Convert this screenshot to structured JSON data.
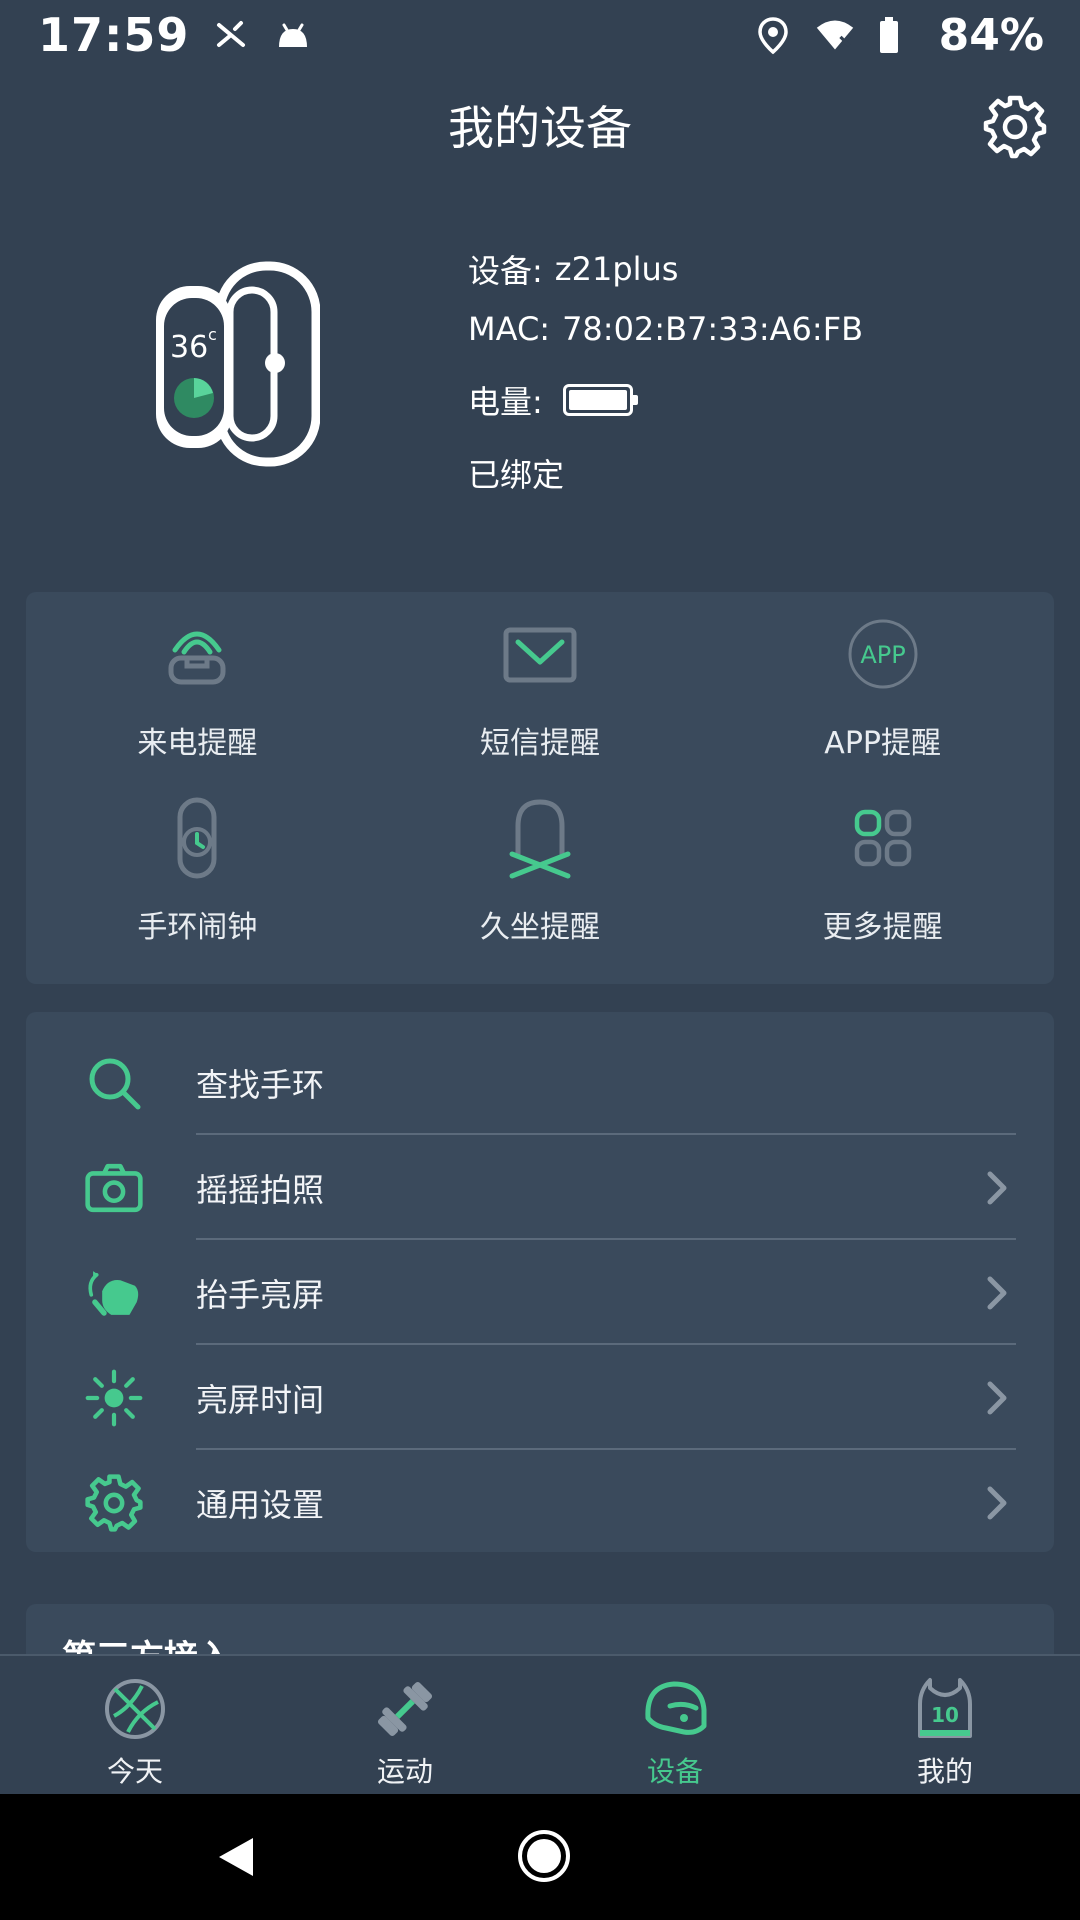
{
  "status": {
    "time": "17:59",
    "battery_percent": "84%"
  },
  "header": {
    "title": "我的设备"
  },
  "device": {
    "name_label": "设备:",
    "name_value": "z21plus",
    "mac_label": "MAC:",
    "mac_value": "78:02:B7:33:A6:FB",
    "battery_label": "电量:",
    "battery_level": 1.0,
    "bound_status": "已绑定",
    "band_display_temp": "36",
    "band_display_unit": "c"
  },
  "reminders": [
    {
      "label": "来电提醒",
      "icon": "phone-call-icon"
    },
    {
      "label": "短信提醒",
      "icon": "envelope-icon"
    },
    {
      "label": "APP提醒",
      "icon": "app-badge-icon",
      "badge_text": "APP"
    },
    {
      "label": "手环闹钟",
      "icon": "band-alarm-icon"
    },
    {
      "label": "久坐提醒",
      "icon": "sedentary-bell-icon"
    },
    {
      "label": "更多提醒",
      "icon": "more-grid-icon"
    }
  ],
  "settings_list": [
    {
      "label": "查找手环",
      "icon": "search-icon",
      "has_chevron": false
    },
    {
      "label": "摇摇拍照",
      "icon": "camera-icon",
      "has_chevron": true
    },
    {
      "label": "抬手亮屏",
      "icon": "raise-hand-icon",
      "has_chevron": true
    },
    {
      "label": "亮屏时间",
      "icon": "brightness-icon",
      "has_chevron": true
    },
    {
      "label": "通用设置",
      "icon": "gear-icon",
      "has_chevron": true
    }
  ],
  "third_party": {
    "title": "第三方接入"
  },
  "bottom_nav": [
    {
      "label": "今天",
      "icon": "basketball-icon",
      "active": false
    },
    {
      "label": "运动",
      "icon": "dumbbell-icon",
      "active": false
    },
    {
      "label": "设备",
      "icon": "helmet-icon",
      "active": true
    },
    {
      "label": "我的",
      "icon": "jersey-icon",
      "active": false,
      "badge": "10"
    }
  ],
  "colors": {
    "background": "#334152",
    "card": "#3a4a5c",
    "accent": "#46c98e",
    "icon_gray": "#6d7a88"
  }
}
